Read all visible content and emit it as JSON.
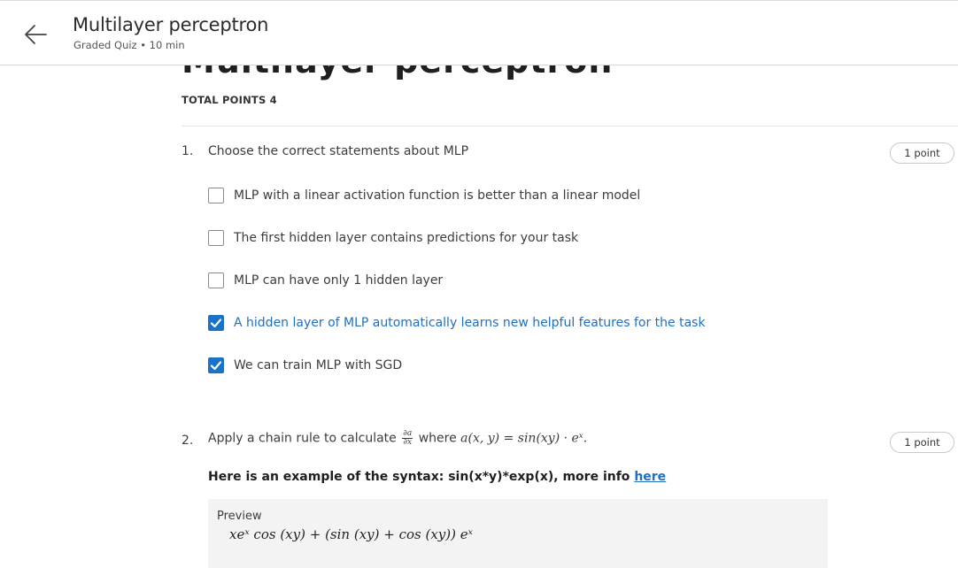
{
  "header": {
    "title": "Multilayer perceptron",
    "subtitle": "Graded Quiz • 10 min"
  },
  "page": {
    "heading": "Multilayer perceptron",
    "total_points": "TOTAL POINTS 4"
  },
  "questions": [
    {
      "number": "1.",
      "text": "Choose the correct statements about MLP",
      "points": "1 point",
      "options": [
        {
          "label": "MLP with a linear activation function is better than a linear model",
          "checked": false
        },
        {
          "label": "The first hidden layer contains predictions for your task",
          "checked": false
        },
        {
          "label": "MLP can have only 1 hidden layer",
          "checked": false
        },
        {
          "label": "A hidden layer of MLP automatically learns new helpful features for the task",
          "checked": true
        },
        {
          "label": "We can train MLP with SGD",
          "checked": true
        }
      ]
    },
    {
      "number": "2.",
      "text_before": "Apply a chain rule to calculate",
      "frac_num": "∂a",
      "frac_den": "∂x",
      "text_where": "where",
      "formula": "a(x, y) = sin(xy) · eˣ.",
      "points": "1 point",
      "syntax_hint": "Here is an example of the syntax: sin(x*y)*exp(x), more info",
      "syntax_link": "here",
      "preview_label": "Preview",
      "preview_math": "xeˣ cos (xy) + (sin (xy) + cos (xy)) eˣ"
    }
  ],
  "colors": {
    "accent": "#1a73c9",
    "link": "#1f6fc5"
  }
}
